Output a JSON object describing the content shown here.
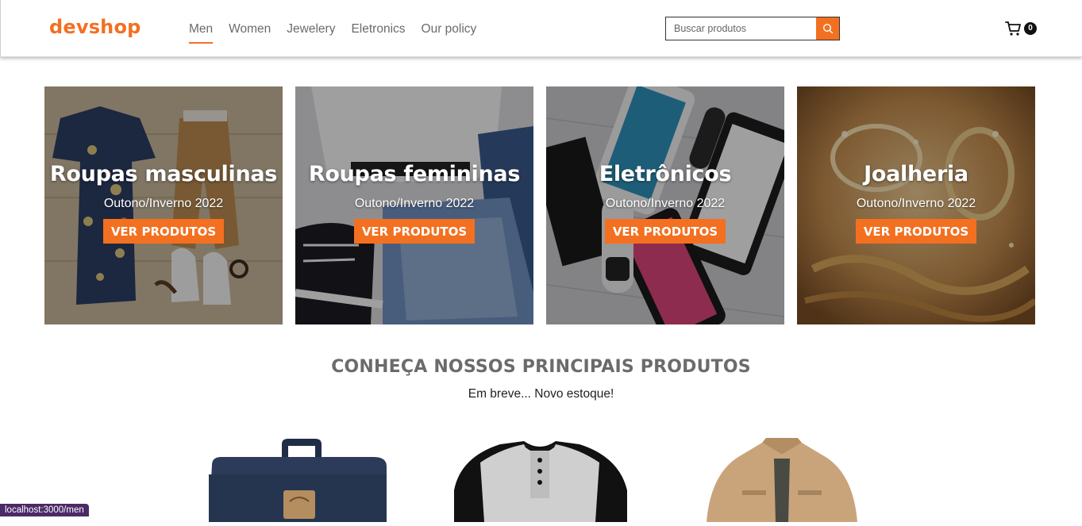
{
  "header": {
    "logo": "devshop",
    "nav": [
      {
        "label": "Men",
        "active": true
      },
      {
        "label": "Women",
        "active": false
      },
      {
        "label": "Jewelery",
        "active": false
      },
      {
        "label": "Eletronics",
        "active": false
      },
      {
        "label": "Our policy",
        "active": false
      }
    ],
    "search": {
      "placeholder": "Buscar produtos",
      "value": ""
    },
    "cart_count": "0"
  },
  "banners": [
    {
      "title": "Roupas masculinas",
      "subtitle": "Outono/Inverno 2022",
      "button": "VER PRODUTOS"
    },
    {
      "title": "Roupas femininas",
      "subtitle": "Outono/Inverno 2022",
      "button": "VER PRODUTOS"
    },
    {
      "title": "Eletrônicos",
      "subtitle": "Outono/Inverno 2022",
      "button": "VER PRODUTOS"
    },
    {
      "title": "Joalheria",
      "subtitle": "Outono/Inverno 2022",
      "button": "VER PRODUTOS"
    }
  ],
  "section": {
    "title": "CONHEÇA NOSSOS PRINCIPAIS PRODUTOS",
    "subtitle": "Em breve... Novo estoque!"
  },
  "products": [
    {
      "icon": "backpack-image"
    },
    {
      "icon": "henley-shirt-image"
    },
    {
      "icon": "jacket-image"
    }
  ],
  "status_bar": "localhost:3000/men",
  "colors": {
    "accent": "#f37021",
    "text_gray": "#6b6b6b",
    "status_bar": "#4b2a66"
  }
}
